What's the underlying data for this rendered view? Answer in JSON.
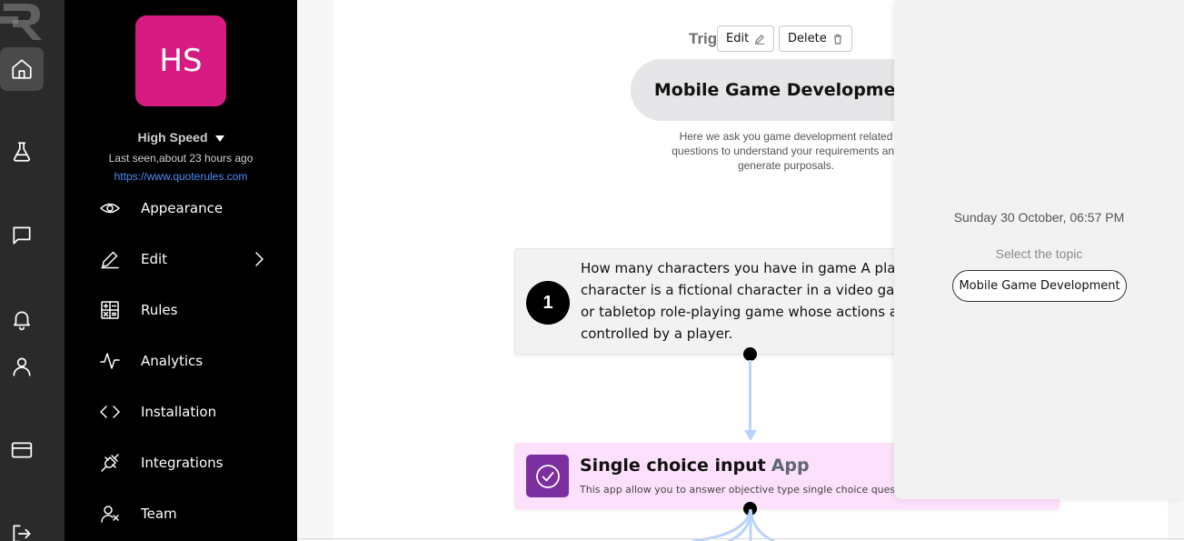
{
  "profile": {
    "initials": "HS",
    "name": "High Speed",
    "last_seen": "Last seen,about 23 hours ago",
    "website": "https://www.quoterules.com",
    "avatar_color": "#d81b82"
  },
  "rail": {
    "items": [
      {
        "name": "home-icon",
        "active": true
      },
      {
        "name": "flask-icon",
        "active": false
      },
      {
        "name": "chat-icon",
        "active": false
      },
      {
        "name": "bell-icon",
        "active": false
      },
      {
        "name": "user-icon",
        "active": false
      },
      {
        "name": "credit-card-icon",
        "active": false
      },
      {
        "name": "logout-icon",
        "active": false
      }
    ]
  },
  "menu": {
    "items": [
      {
        "label": "Appearance",
        "icon": "eye-icon"
      },
      {
        "label": "Edit",
        "icon": "pen-icon",
        "has_submenu": true
      },
      {
        "label": "Rules",
        "icon": "rules-icon"
      },
      {
        "label": "Analytics",
        "icon": "pulse-icon"
      },
      {
        "label": "Installation",
        "icon": "code-icon"
      },
      {
        "label": "Integrations",
        "icon": "plug-icon"
      },
      {
        "label": "Team",
        "icon": "team-icon"
      }
    ]
  },
  "flow": {
    "trigger_label": "Trigger:",
    "edit_label": "Edit",
    "delete_label": "Delete",
    "trigger_title": "Mobile Game Development",
    "trigger_description": "Here we ask you game development related questions to understand your requirements and generate purposals.",
    "question": {
      "number": "1",
      "text": "How many characters you have in game A player character is a fictional character in a video game or tabletop role-playing game whose actions are controlled by a player."
    },
    "app": {
      "title": "Single choice input",
      "badge": "App",
      "description": "This app allow you to answer objective type single choice questions.",
      "color": "#7b2fa0",
      "background": "#fde0fb"
    },
    "connector_color": "#b9d3fb"
  },
  "panel": {
    "date": "Sunday 30 October, 06:57 PM",
    "prompt": "Select the topic",
    "topic_button": "Mobile Game Development"
  }
}
